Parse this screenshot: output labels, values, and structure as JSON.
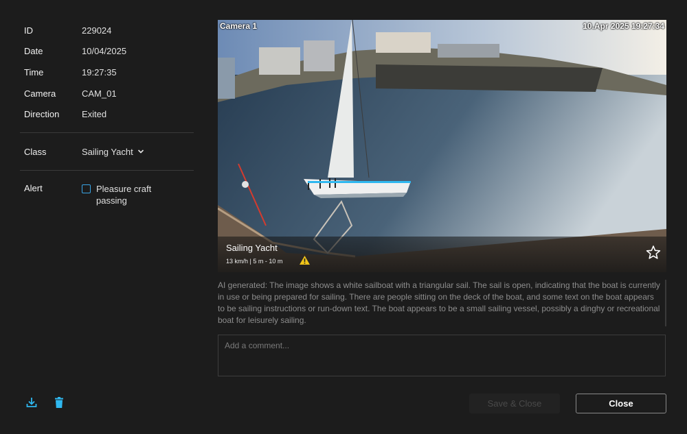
{
  "details": {
    "id_label": "ID",
    "id_value": "229024",
    "date_label": "Date",
    "date_value": "10/04/2025",
    "time_label": "Time",
    "time_value": "19:27:35",
    "camera_label": "Camera",
    "camera_value": "CAM_01",
    "direction_label": "Direction",
    "direction_value": "Exited"
  },
  "classification": {
    "label": "Class",
    "value": "Sailing Yacht"
  },
  "alert": {
    "label": "Alert",
    "option": "Pleasure craft passing",
    "checked": false
  },
  "footer_icons": [
    "download-icon",
    "trash-icon"
  ],
  "media": {
    "camera_overlay": "Camera 1",
    "timestamp_overlay": "10.Apr 2025  19:27:34",
    "object_title": "Sailing Yacht",
    "object_info": "13 km/h | 5 m - 10 m",
    "icons": [
      "warning-icon",
      "star-icon"
    ],
    "accent_color": "#2fb8f0"
  },
  "ai_description": "AI generated: The image shows a white sailboat with a triangular sail. The sail is open, indicating that the boat is currently in use or being prepared for sailing. There are people sitting on the deck of the boat, and some text on the boat appears to be sailing instructions or run-down text. The boat appears to be a small sailing vessel, possibly a dinghy or recreational boat for leisurely sailing.",
  "comment": {
    "placeholder": "Add a comment...",
    "value": ""
  },
  "buttons": {
    "save": "Save & Close",
    "close": "Close"
  }
}
